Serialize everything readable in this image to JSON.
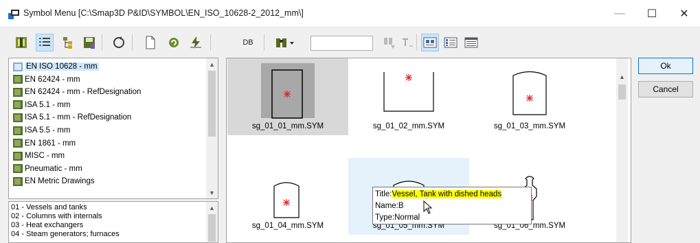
{
  "window": {
    "title": "Symbol Menu [C:\\Smap3D P&ID\\SYMBOL\\EN_ISO_10628-2_2012_mm\\]",
    "minimize_glyph": "—",
    "maximize_glyph": "☐",
    "close_glyph": "✕"
  },
  "toolbar": {
    "db_label": "DB",
    "search_value": "",
    "icons": [
      "library-icon",
      "list-view-icon",
      "tree-icon",
      "save-icon",
      "cycle-icon",
      "new-document-icon",
      "refresh-icon",
      "flash-icon",
      "binoculars-icon",
      "find-next-icon",
      "text-icon",
      "large-icons-view-icon",
      "small-icons-view-icon",
      "details-view-icon"
    ]
  },
  "tree": {
    "items": [
      {
        "label": "EN ISO 10628 - mm",
        "selected": true
      },
      {
        "label": "EN 62424 - mm"
      },
      {
        "label": "EN 62424 - mm - RefDesignation"
      },
      {
        "label": "ISA 5.1 - mm"
      },
      {
        "label": "ISA 5.1 - mm - RefDesignation"
      },
      {
        "label": "ISA 5.5 - mm"
      },
      {
        "label": "EN 1861 - mm"
      },
      {
        "label": "MISC - mm"
      },
      {
        "label": "Pneumatic - mm"
      },
      {
        "label": "EN Metric Drawings"
      }
    ]
  },
  "categories": {
    "items": [
      "01 - Vessels and tanks",
      "02 - Columns with internals",
      "03 - Heat exchangers",
      "04 - Steam generators; furnaces"
    ]
  },
  "symbols": {
    "items": [
      {
        "label": "sg_01_01_mm.SYM"
      },
      {
        "label": "sg_01_02_mm.SYM"
      },
      {
        "label": "sg_01_03_mm.SYM"
      },
      {
        "label": "sg_01_04_mm.SYM"
      },
      {
        "label": "sg_01_05_mm.SYM"
      },
      {
        "label": "sg_01_06_mm.SYM"
      }
    ],
    "marker_color": "#e02020",
    "selected_color": "#d8d8d8",
    "hover_color": "#e5f1fb"
  },
  "tooltip": {
    "title_key": "Title:",
    "title_value": "Vessel, Tank with dished heads",
    "name_line": "Name:B",
    "type_line": "Type:Normal"
  },
  "buttons": {
    "ok": "Ok",
    "cancel": "Cancel"
  }
}
